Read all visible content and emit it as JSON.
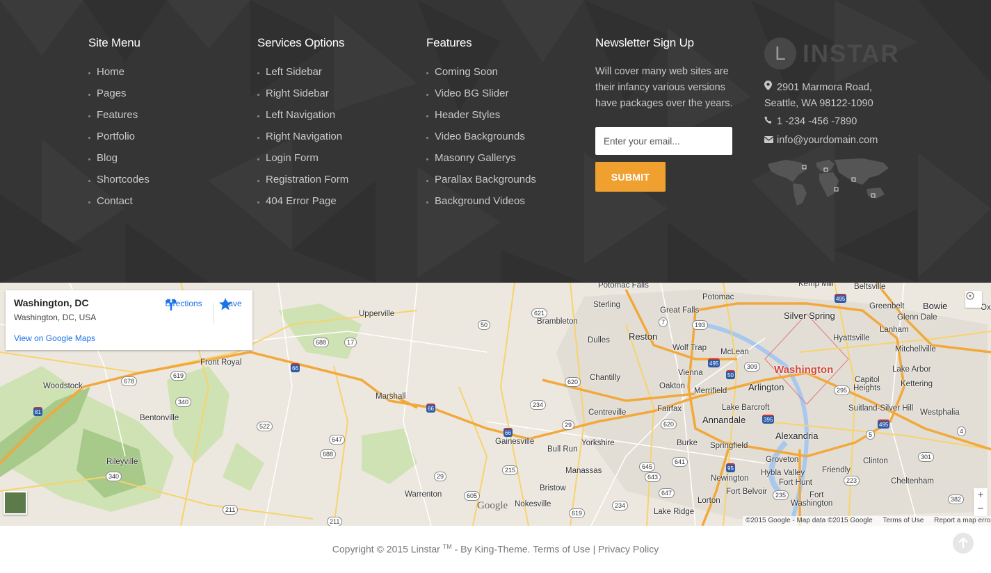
{
  "site_menu": {
    "title": "Site Menu",
    "items": [
      "Home",
      "Pages",
      "Features",
      "Portfolio",
      "Blog",
      "Shortcodes",
      "Contact"
    ]
  },
  "services": {
    "title": "Services Options",
    "items": [
      "Left Sidebar",
      "Right Sidebar",
      "Left Navigation",
      "Right Navigation",
      "Login Form",
      "Registration Form",
      "404 Error Page"
    ]
  },
  "features": {
    "title": "Features",
    "items": [
      "Coming Soon",
      "Video BG Slider",
      "Header Styles",
      "Video Backgrounds",
      "Masonry Gallerys",
      "Parallax Backgrounds",
      "Background Videos"
    ]
  },
  "newsletter": {
    "title": "Newsletter Sign Up",
    "text": "Will cover many web sites are their infancy various versions have packages over the years.",
    "email_placeholder": "Enter your email...",
    "submit_label": "SUBMIT"
  },
  "brand": {
    "letter": "L",
    "name": "INSTAR",
    "address_line1": "2901 Marmora Road,",
    "address_line2": "Seattle, WA 98122-1090",
    "phone": "1 -234 -456 -7890",
    "email": "info@yourdomain.com"
  },
  "map": {
    "card_title": "Washington, DC",
    "card_subtitle": "Washington, DC, USA",
    "view_link": "View on Google Maps",
    "directions_label": "Directions",
    "save_label": "Save",
    "zoom_in": "+",
    "zoom_out": "−",
    "google_logo": "Google",
    "attribution": "©2015 Google - Map data ©2015 Google",
    "terms": "Terms of Use",
    "report": "Report a map error",
    "places": {
      "potomac_falls": "Potomac Falls",
      "sterling": "Sterling",
      "great_falls": "Great Falls",
      "potomac": "Potomac",
      "kemp_mill": "Kemp Mill",
      "beltsville": "Beltsville",
      "greenbelt": "Greenbelt",
      "bowie": "Bowie",
      "silver_spring": "Silver Spring",
      "glenn_dale": "Glenn Dale",
      "lanham": "Lanham",
      "hyattsville": "Hyattsville",
      "mitchellville": "Mitchellville",
      "upperville": "Upperville",
      "brambleton": "Brambleton",
      "dulles": "Dulles",
      "reston": "Reston",
      "wolf_trap": "Wolf Trap",
      "mclean": "McLean",
      "washington": "Washington",
      "capitol_heights_1": "Capitol",
      "capitol_heights_2": "Heights",
      "lake_arbor": "Lake Arbor",
      "kettering": "Kettering",
      "front_royal": "Front Royal",
      "woodstock": "Woodstock",
      "chantilly": "Chantilly",
      "vienna": "Vienna",
      "arlington": "Arlington",
      "oakton": "Oakton",
      "merrifield": "Merrifield",
      "marshall": "Marshall",
      "fairfax": "Fairfax",
      "lake_barcroft": "Lake Barcroft",
      "suitland": "Suitland-Silver Hill",
      "westphalia": "Westphalia",
      "bentonville": "Bentonville",
      "centreville": "Centreville",
      "annandale": "Annandale",
      "alexandria": "Alexandria",
      "gainesville": "Gainesville",
      "yorkshire": "Yorkshire",
      "burke": "Burke",
      "springfield": "Springfield",
      "bull_run": "Bull Run",
      "rileyville": "Rileyville",
      "manassas": "Manassas",
      "groveton": "Groveton",
      "clinton": "Clinton",
      "hybla_valley": "Hybla Valley",
      "friendly": "Friendly",
      "newington": "Newington",
      "fort_hunt": "Fort Hunt",
      "cheltenham": "Cheltenham",
      "bristow": "Bristow",
      "fort_belvoir": "Fort Belvoir",
      "fort": "Fort",
      "warrenton": "Warrenton",
      "nokesville": "Nokesville",
      "lorton": "Lorton",
      "fort_washington": "Washington",
      "lake_ridge": "Lake Ridge",
      "oxon": "Oxon"
    },
    "shields": [
      "688",
      "17",
      "50",
      "621",
      "7",
      "193",
      "495",
      "309",
      "495",
      "50",
      "295",
      "678",
      "619",
      "340",
      "66",
      "620",
      "234",
      "66",
      "29",
      "620",
      "522",
      "647",
      "688",
      "66",
      "215",
      "641",
      "95",
      "645",
      "643",
      "395",
      "5",
      "4",
      "301",
      "340",
      "29",
      "605",
      "647",
      "235",
      "223",
      "382",
      "211",
      "211",
      "234",
      "619",
      "495",
      "81"
    ]
  },
  "copyright": {
    "prefix": "Copyright © 2015 Linstar",
    "tm": "TM",
    "by": " - By King-Theme.",
    "terms": "Terms of Use",
    "sep": "|",
    "privacy": "Privacy Policy"
  },
  "colors": {
    "footer_bg": "#353535",
    "accent": "#f0a02f",
    "link_blue": "#1a73e8",
    "city_red": "#d2463c"
  },
  "icons": [
    "map-marker-icon",
    "phone-icon",
    "envelope-icon",
    "world-map-icon",
    "directions-icon",
    "star-icon",
    "back-to-top-icon",
    "street-view-icon"
  ]
}
